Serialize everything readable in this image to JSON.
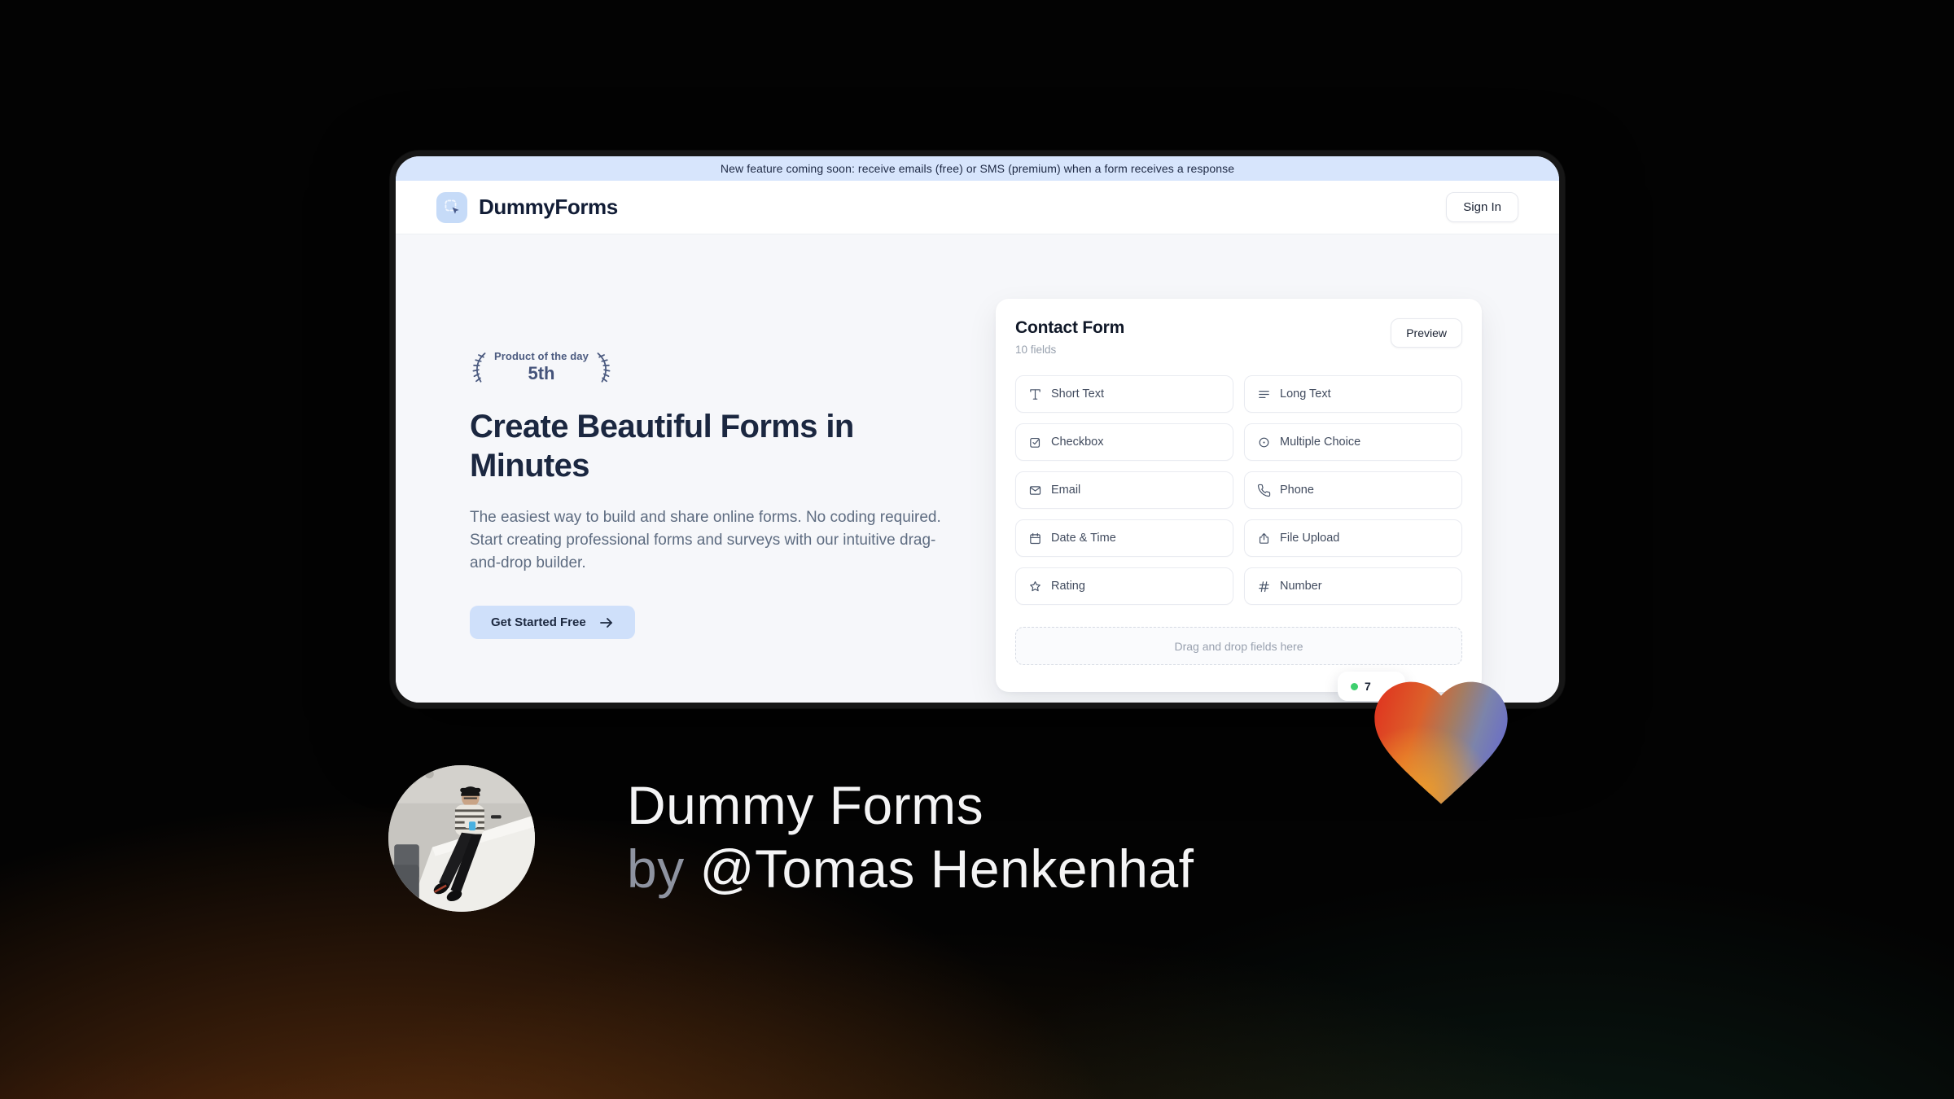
{
  "banner": {
    "text": "New feature coming soon: receive emails (free) or SMS (premium) when a form receives a response"
  },
  "header": {
    "brand": "DummyForms",
    "sign_in": "Sign In"
  },
  "hero": {
    "badge_top": "Product of the day",
    "badge_rank": "5th",
    "title": "Create Beautiful Forms in\nMinutes",
    "description": "The easiest way to build and share online forms. No coding required.\nStart creating professional forms and surveys with our intuitive drag-\nand-drop builder.",
    "cta": "Get Started Free"
  },
  "form_card": {
    "title": "Contact Form",
    "subtitle": "10 fields",
    "preview": "Preview",
    "fields": [
      {
        "id": "short-text",
        "label": "Short Text",
        "symbol": "i-type",
        "icon_name": "type-icon"
      },
      {
        "id": "long-text",
        "label": "Long Text",
        "symbol": "i-align",
        "icon_name": "align-left-icon"
      },
      {
        "id": "checkbox",
        "label": "Checkbox",
        "symbol": "i-check",
        "icon_name": "checkbox-icon"
      },
      {
        "id": "multiple-choice",
        "label": "Multiple Choice",
        "symbol": "i-radio",
        "icon_name": "circle-dot-icon"
      },
      {
        "id": "email",
        "label": "Email",
        "symbol": "i-mail",
        "icon_name": "mail-icon"
      },
      {
        "id": "phone",
        "label": "Phone",
        "symbol": "i-phone",
        "icon_name": "phone-icon"
      },
      {
        "id": "date-time",
        "label": "Date & Time",
        "symbol": "i-cal",
        "icon_name": "calendar-icon"
      },
      {
        "id": "file-upload",
        "label": "File Upload",
        "symbol": "i-upload",
        "icon_name": "upload-icon"
      },
      {
        "id": "rating",
        "label": "Rating",
        "symbol": "i-star",
        "icon_name": "star-icon"
      },
      {
        "id": "number",
        "label": "Number",
        "symbol": "i-hash",
        "icon_name": "hash-icon"
      }
    ],
    "dropzone": "Drag and drop fields here",
    "badge_count": "7"
  },
  "footer": {
    "title": "Dummy Forms",
    "byline_prefix": "by ",
    "byline_handle": "@Tomas Henkenhaf"
  },
  "colors": {
    "accent_blue": "#cfe0fa",
    "banner_bg": "#d7e5fc",
    "brand_navy": "#121d36",
    "green_dot": "#3ecf6e",
    "heart_red": "#e03322",
    "heart_orange": "#f49d27",
    "heart_blue": "#6c70c5"
  }
}
